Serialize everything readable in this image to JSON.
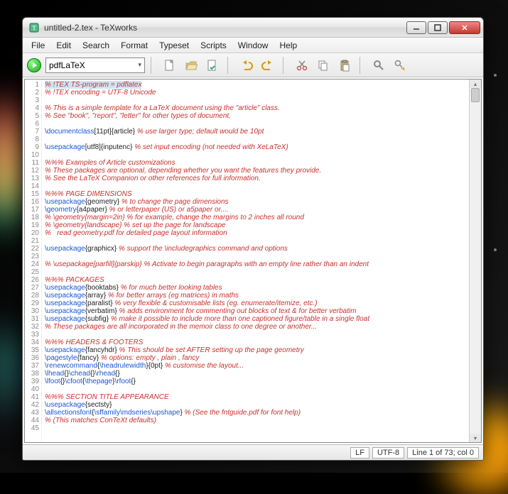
{
  "window": {
    "title": "untitled-2.tex - TeXworks"
  },
  "menus": {
    "file": "File",
    "edit": "Edit",
    "search": "Search",
    "format": "Format",
    "typeset": "Typeset",
    "scripts": "Scripts",
    "window": "Window",
    "help": "Help"
  },
  "toolbar": {
    "engine": "pdfLaTeX"
  },
  "status": {
    "eol": "LF",
    "enc": "UTF-8",
    "pos": "Line 1 of 73; col 0"
  },
  "lines": [
    {
      "n": "1",
      "seg": [
        {
          "t": "% !TEX TS-program = pdflatex",
          "c": "c-red hl"
        }
      ]
    },
    {
      "n": "2",
      "seg": [
        {
          "t": "% !TEX encoding = UTF-8 Unicode",
          "c": "c-red"
        }
      ]
    },
    {
      "n": "3",
      "seg": [
        {
          "t": ""
        }
      ]
    },
    {
      "n": "4",
      "seg": [
        {
          "t": "% This is a simple template for a LaTeX document using the \"article\" class.",
          "c": "c-red"
        }
      ]
    },
    {
      "n": "5",
      "seg": [
        {
          "t": "% See \"book\", \"report\", \"letter\" for other types of document.",
          "c": "c-red"
        }
      ]
    },
    {
      "n": "6",
      "seg": [
        {
          "t": ""
        }
      ]
    },
    {
      "n": "7",
      "seg": [
        {
          "t": "\\documentclass",
          "c": "c-blue"
        },
        {
          "t": "[11pt]{article} "
        },
        {
          "t": "% use larger type; default would be 10pt",
          "c": "c-red"
        }
      ]
    },
    {
      "n": "8",
      "seg": [
        {
          "t": ""
        }
      ]
    },
    {
      "n": "9",
      "seg": [
        {
          "t": "\\usepackage",
          "c": "c-blue"
        },
        {
          "t": "[utf8]{inputenc} "
        },
        {
          "t": "% set input encoding (not needed with XeLaTeX)",
          "c": "c-red"
        }
      ]
    },
    {
      "n": "10",
      "seg": [
        {
          "t": ""
        }
      ]
    },
    {
      "n": "11",
      "seg": [
        {
          "t": "%%% Examples of Article customizations",
          "c": "c-red"
        }
      ]
    },
    {
      "n": "12",
      "seg": [
        {
          "t": "% These packages are optional, depending whether you want the features they provide.",
          "c": "c-red"
        }
      ]
    },
    {
      "n": "13",
      "seg": [
        {
          "t": "% See the LaTeX Companion or other references for full information.",
          "c": "c-red"
        }
      ]
    },
    {
      "n": "14",
      "seg": [
        {
          "t": ""
        }
      ]
    },
    {
      "n": "15",
      "seg": [
        {
          "t": "%%% PAGE DIMENSIONS",
          "c": "c-red"
        }
      ]
    },
    {
      "n": "16",
      "seg": [
        {
          "t": "\\usepackage",
          "c": "c-blue"
        },
        {
          "t": "{geometry} "
        },
        {
          "t": "% to change the page dimensions",
          "c": "c-red"
        }
      ]
    },
    {
      "n": "17",
      "seg": [
        {
          "t": "\\geometry",
          "c": "c-blue"
        },
        {
          "t": "{a4paper} "
        },
        {
          "t": "% or letterpaper (US) or a5paper or....",
          "c": "c-red"
        }
      ]
    },
    {
      "n": "18",
      "seg": [
        {
          "t": "% \\geometry{margin=2in} % for example, change the margins to 2 inches all round",
          "c": "c-red"
        }
      ]
    },
    {
      "n": "19",
      "seg": [
        {
          "t": "% \\geometry{landscape} % set up the page for landscape",
          "c": "c-red"
        }
      ]
    },
    {
      "n": "20",
      "seg": [
        {
          "t": "%   read geometry.pdf for detailed page layout information",
          "c": "c-red"
        }
      ]
    },
    {
      "n": "21",
      "seg": [
        {
          "t": ""
        }
      ]
    },
    {
      "n": "22",
      "seg": [
        {
          "t": "\\usepackage",
          "c": "c-blue"
        },
        {
          "t": "{graphicx} "
        },
        {
          "t": "% support the \\includegraphics command and options",
          "c": "c-red"
        }
      ]
    },
    {
      "n": "23",
      "seg": [
        {
          "t": ""
        }
      ]
    },
    {
      "n": "24",
      "seg": [
        {
          "t": "% \\usepackage[parfill]{parskip} % Activate to begin paragraphs with an empty line rather than an indent",
          "c": "c-red"
        }
      ]
    },
    {
      "n": "25",
      "seg": [
        {
          "t": ""
        }
      ]
    },
    {
      "n": "26",
      "seg": [
        {
          "t": "%%% PACKAGES",
          "c": "c-red"
        }
      ]
    },
    {
      "n": "27",
      "seg": [
        {
          "t": "\\usepackage",
          "c": "c-blue"
        },
        {
          "t": "{booktabs} "
        },
        {
          "t": "% for much better looking tables",
          "c": "c-red"
        }
      ]
    },
    {
      "n": "28",
      "seg": [
        {
          "t": "\\usepackage",
          "c": "c-blue"
        },
        {
          "t": "{array} "
        },
        {
          "t": "% for better arrays (eg matrices) in maths",
          "c": "c-red"
        }
      ]
    },
    {
      "n": "29",
      "seg": [
        {
          "t": "\\usepackage",
          "c": "c-blue"
        },
        {
          "t": "{paralist} "
        },
        {
          "t": "% very flexible & customisable lists (eg. enumerate/itemize, etc.)",
          "c": "c-red"
        }
      ]
    },
    {
      "n": "30",
      "seg": [
        {
          "t": "\\usepackage",
          "c": "c-blue"
        },
        {
          "t": "{verbatim} "
        },
        {
          "t": "% adds environment for commenting out blocks of text & for better verbatim",
          "c": "c-red"
        }
      ]
    },
    {
      "n": "31",
      "seg": [
        {
          "t": "\\usepackage",
          "c": "c-blue"
        },
        {
          "t": "{subfig} "
        },
        {
          "t": "% make it possible to include more than one captioned figure/table in a single float",
          "c": "c-red"
        }
      ]
    },
    {
      "n": "32",
      "seg": [
        {
          "t": "% These packages are all incorporated in the memoir class to one degree or another...",
          "c": "c-red"
        }
      ]
    },
    {
      "n": "33",
      "seg": [
        {
          "t": ""
        }
      ]
    },
    {
      "n": "34",
      "seg": [
        {
          "t": "%%% HEADERS & FOOTERS",
          "c": "c-red"
        }
      ]
    },
    {
      "n": "35",
      "seg": [
        {
          "t": "\\usepackage",
          "c": "c-blue"
        },
        {
          "t": "{fancyhdr} "
        },
        {
          "t": "% This should be set AFTER setting up the page geometry",
          "c": "c-red"
        }
      ]
    },
    {
      "n": "36",
      "seg": [
        {
          "t": "\\pagestyle",
          "c": "c-blue"
        },
        {
          "t": "{fancy} "
        },
        {
          "t": "% options: empty , plain , fancy",
          "c": "c-red"
        }
      ]
    },
    {
      "n": "37",
      "seg": [
        {
          "t": "\\renewcommand",
          "c": "c-blue"
        },
        {
          "t": "{"
        },
        {
          "t": "\\headrulewidth",
          "c": "c-blue"
        },
        {
          "t": "}{0pt} "
        },
        {
          "t": "% customise the layout...",
          "c": "c-red"
        }
      ]
    },
    {
      "n": "38",
      "seg": [
        {
          "t": "\\lhead",
          "c": "c-blue"
        },
        {
          "t": "{}"
        },
        {
          "t": "\\chead",
          "c": "c-blue"
        },
        {
          "t": "{}"
        },
        {
          "t": "\\rhead",
          "c": "c-blue"
        },
        {
          "t": "{}"
        }
      ]
    },
    {
      "n": "39",
      "seg": [
        {
          "t": "\\lfoot",
          "c": "c-blue"
        },
        {
          "t": "{}"
        },
        {
          "t": "\\cfoot",
          "c": "c-blue"
        },
        {
          "t": "{"
        },
        {
          "t": "\\thepage",
          "c": "c-blue"
        },
        {
          "t": "}"
        },
        {
          "t": "\\rfoot",
          "c": "c-blue"
        },
        {
          "t": "{}"
        }
      ]
    },
    {
      "n": "40",
      "seg": [
        {
          "t": ""
        }
      ]
    },
    {
      "n": "41",
      "seg": [
        {
          "t": "%%% SECTION TITLE APPEARANCE",
          "c": "c-red"
        }
      ]
    },
    {
      "n": "42",
      "seg": [
        {
          "t": "\\usepackage",
          "c": "c-blue"
        },
        {
          "t": "{sectsty}"
        }
      ]
    },
    {
      "n": "43",
      "seg": [
        {
          "t": "\\allsectionsfont",
          "c": "c-blue"
        },
        {
          "t": "{"
        },
        {
          "t": "\\sffamily\\mdseries\\upshape",
          "c": "c-blue"
        },
        {
          "t": "} "
        },
        {
          "t": "% (See the fntguide.pdf for font help)",
          "c": "c-red"
        }
      ]
    },
    {
      "n": "44",
      "seg": [
        {
          "t": "% (This matches ConTeXt defaults)",
          "c": "c-red"
        }
      ]
    },
    {
      "n": "45",
      "seg": [
        {
          "t": ""
        }
      ]
    }
  ]
}
